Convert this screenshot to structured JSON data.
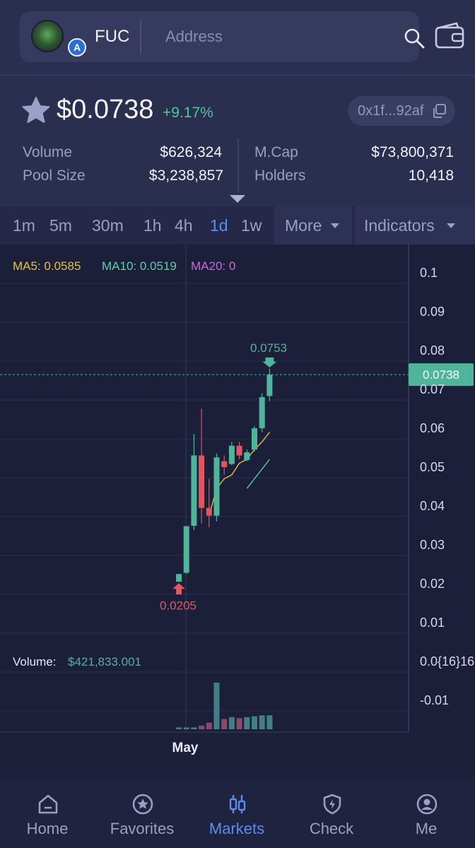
{
  "header": {
    "token_symbol": "FUC",
    "search_placeholder": "Address",
    "icons": [
      "search-icon",
      "wallet-icon"
    ]
  },
  "price_info": {
    "price": "$0.0738",
    "change": "+9.17%",
    "contract": "0x1f...92af",
    "star_icon": "star-icon",
    "copy_icon": "copy-icon"
  },
  "stats": {
    "volume_label": "Volume",
    "volume_value": "$626,324",
    "pool_label": "Pool Size",
    "pool_value": "$3,238,857",
    "mcap_label": "M.Cap",
    "mcap_value": "$73,800,371",
    "holders_label": "Holders",
    "holders_value": "10,418"
  },
  "timeframes": [
    "1m",
    "5m",
    "30m",
    "1h",
    "4h",
    "1d",
    "1w"
  ],
  "active_timeframe": "1d",
  "dropdowns": {
    "more": "More",
    "indicators": "Indicators"
  },
  "colors": {
    "up": "#4fb59a",
    "down": "#e0565f",
    "ma5": "#e2c23c",
    "ma10": "#5fd0a8",
    "ma20": "#c86bd9",
    "accent": "#5b8cf0"
  },
  "chart_data": {
    "type": "candlestick",
    "legend": [
      {
        "label": "MA5: 0.0585",
        "color": "#e2c23c"
      },
      {
        "label": "MA10: 0.0519",
        "color": "#5fd0a8"
      },
      {
        "label": "MA20: 0",
        "color": "#c86bd9"
      }
    ],
    "y_ticks": [
      "0.1",
      "0.09",
      "0.08",
      "0.07",
      "0.06",
      "0.05",
      "0.04",
      "0.03",
      "0.02",
      "0.01",
      "0.0{16}16",
      "-0.01"
    ],
    "y_range": [
      -0.015,
      0.105
    ],
    "x_label": "May",
    "current_price": "0.0738",
    "current_value": 0.0738,
    "high_label": "0.0753",
    "high_value": 0.0753,
    "low_label": "0.0205",
    "low_value": 0.0205,
    "volume_label": "Volume:",
    "volume_value": "$421,833.001",
    "candles": [
      {
        "o": 0.0205,
        "h": 0.0225,
        "l": 0.0205,
        "c": 0.0225
      },
      {
        "o": 0.0228,
        "h": 0.0348,
        "l": 0.0226,
        "c": 0.0348
      },
      {
        "o": 0.0349,
        "h": 0.0585,
        "l": 0.0338,
        "c": 0.053
      },
      {
        "o": 0.053,
        "h": 0.065,
        "l": 0.0355,
        "c": 0.0395
      },
      {
        "o": 0.0395,
        "h": 0.047,
        "l": 0.0345,
        "c": 0.0375
      },
      {
        "o": 0.0375,
        "h": 0.0535,
        "l": 0.036,
        "c": 0.0525
      },
      {
        "o": 0.0515,
        "h": 0.053,
        "l": 0.048,
        "c": 0.05
      },
      {
        "o": 0.0508,
        "h": 0.0565,
        "l": 0.0505,
        "c": 0.0555
      },
      {
        "o": 0.0555,
        "h": 0.0565,
        "l": 0.052,
        "c": 0.053
      },
      {
        "o": 0.0518,
        "h": 0.0545,
        "l": 0.0515,
        "c": 0.0538
      },
      {
        "o": 0.0545,
        "h": 0.0605,
        "l": 0.054,
        "c": 0.06
      },
      {
        "o": 0.06,
        "h": 0.069,
        "l": 0.059,
        "c": 0.068
      },
      {
        "o": 0.0683,
        "h": 0.0753,
        "l": 0.067,
        "c": 0.0738
      }
    ],
    "ma5": [
      null,
      null,
      null,
      null,
      0.0375,
      0.0445,
      0.047,
      0.048,
      0.051,
      0.052,
      0.0545,
      0.0565,
      0.059
    ],
    "ma10": [
      null,
      null,
      null,
      null,
      null,
      null,
      null,
      null,
      null,
      0.0445,
      0.047,
      0.0495,
      0.052
    ],
    "volumes": [
      0.04,
      0.04,
      0.04,
      0.08,
      0.14,
      1.0,
      0.22,
      0.26,
      0.24,
      0.26,
      0.28,
      0.3,
      0.3
    ]
  },
  "nav": [
    {
      "label": "Home",
      "icon": "home-icon"
    },
    {
      "label": "Favorites",
      "icon": "favorites-icon"
    },
    {
      "label": "Markets",
      "icon": "markets-icon"
    },
    {
      "label": "Check",
      "icon": "check-icon"
    },
    {
      "label": "Me",
      "icon": "profile-icon"
    }
  ],
  "active_nav": "Markets"
}
